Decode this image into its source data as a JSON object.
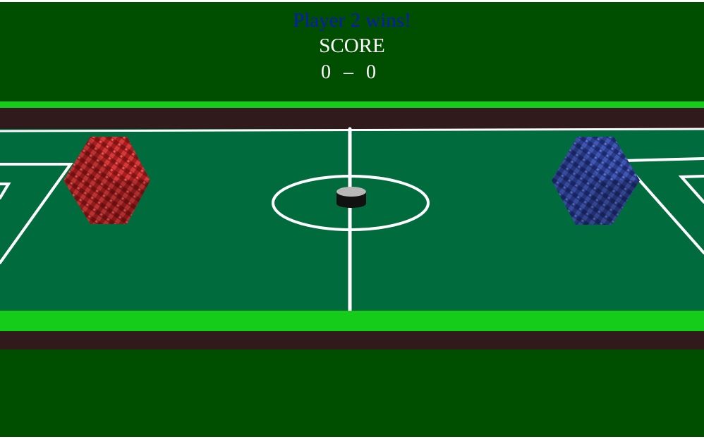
{
  "hud": {
    "win_message": "Player 2 wins!",
    "score_title": "SCORE",
    "score_left": "0",
    "score_separator": "–",
    "score_right": "0"
  },
  "colors": {
    "background": "#004f00",
    "table_felt": "#006b3c",
    "rail_green": "#16cc1a",
    "rail_dark": "#301a1c",
    "lines": "#ffffff",
    "win_text": "#0a1bb3",
    "player1_mallet": "#b52424",
    "player2_mallet": "#2a3f93",
    "puck_top": "#b8b8b8",
    "puck_side": "#111111"
  },
  "objects": {
    "player1_mallet": "red-cube-mallet",
    "player2_mallet": "blue-cube-mallet",
    "puck": "puck"
  }
}
